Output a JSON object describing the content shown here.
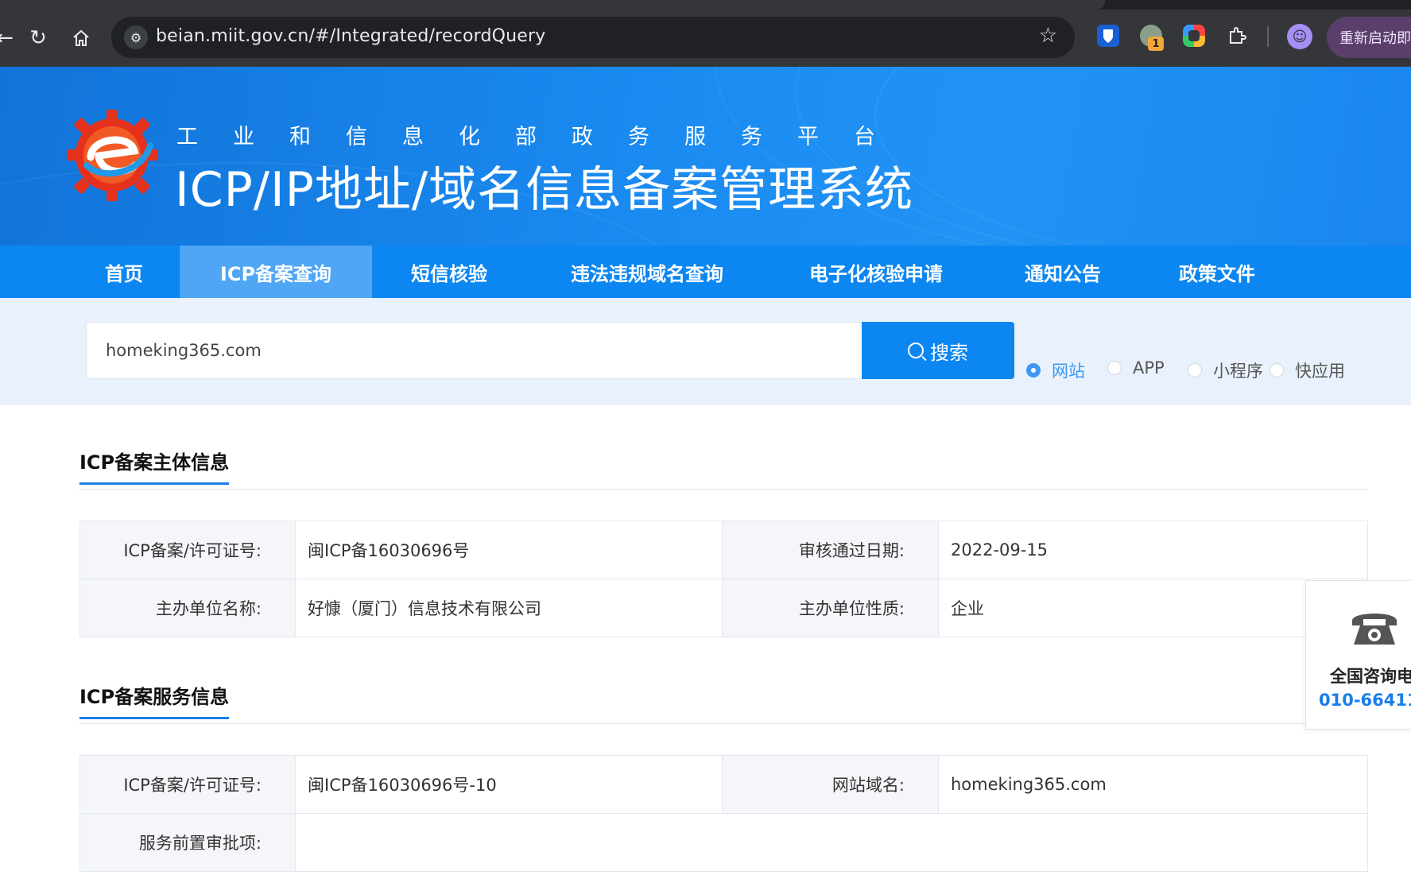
{
  "browser": {
    "url": "beian.miit.gov.cn/#/Integrated/recordQuery",
    "restart_label": "重新启动即",
    "extension_badge": "1"
  },
  "header": {
    "ministry": "工业和信息化部政务服务平台",
    "system_title": "ICP/IP地址/域名信息备案管理系统"
  },
  "nav": {
    "items": [
      {
        "label": "首页"
      },
      {
        "label": "ICP备案查询",
        "active": true
      },
      {
        "label": "短信核验"
      },
      {
        "label": "违法违规域名查询"
      },
      {
        "label": "电子化核验申请"
      },
      {
        "label": "通知公告"
      },
      {
        "label": "政策文件"
      }
    ]
  },
  "search": {
    "value": "homeking365.com",
    "button_label": "搜索",
    "options": [
      {
        "label": "网站",
        "checked": true
      },
      {
        "label": "APP",
        "checked": false
      },
      {
        "label": "小程序",
        "checked": false
      },
      {
        "label": "快应用",
        "checked": false
      }
    ]
  },
  "subject_section": {
    "title": "ICP备案主体信息",
    "rows": [
      {
        "label1": "ICP备案/许可证号:",
        "value1": "闽ICP备16030696号",
        "label2": "审核通过日期:",
        "value2": "2022-09-15"
      },
      {
        "label1": "主办单位名称:",
        "value1": "好慷（厦门）信息技术有限公司",
        "label2": "主办单位性质:",
        "value2": "企业"
      }
    ]
  },
  "service_section": {
    "title": "ICP备案服务信息",
    "rows": [
      {
        "label1": "ICP备案/许可证号:",
        "value1": "闽ICP备16030696号-10",
        "label2": "网站域名:",
        "value2": "homeking365.com"
      },
      {
        "label1": "服务前置审批项:",
        "value1": ""
      }
    ]
  },
  "contact": {
    "label": "全国咨询电",
    "number": "010-664111"
  },
  "colors": {
    "brand_blue": "#0c87f1",
    "active_nav": "#4ea6f5",
    "search_band": "#e9f2fc"
  }
}
